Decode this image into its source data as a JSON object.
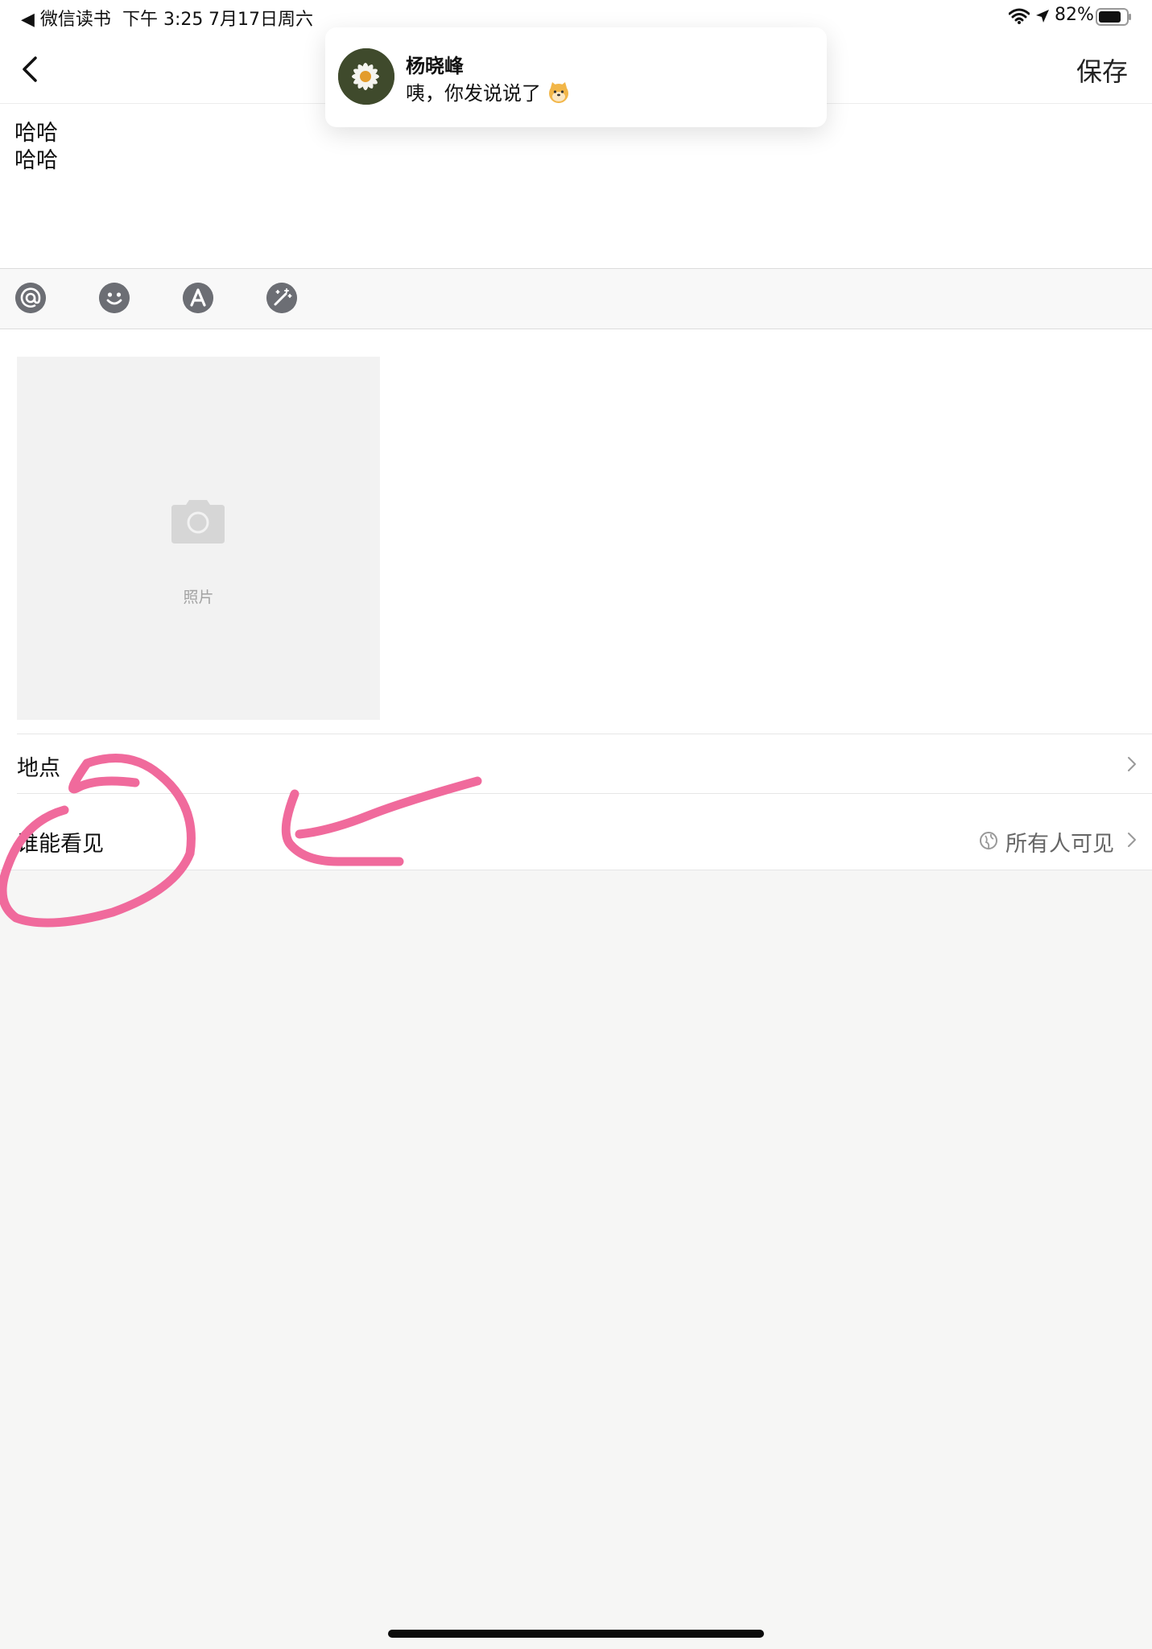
{
  "status_bar": {
    "back_app": "◀ 微信读书",
    "time": "下午 3:25",
    "date": "7月17日周六",
    "battery": "82%"
  },
  "header": {
    "save_label": "保存"
  },
  "notification": {
    "sender": "杨晓峰",
    "message": "咦，你发说说了",
    "avatar_icon": "daisy-photo"
  },
  "editor": {
    "lines": [
      "哈哈",
      "哈哈"
    ]
  },
  "toolbar": {
    "icons": [
      "at-icon",
      "emoji-icon",
      "font-icon",
      "magic-wand-icon"
    ]
  },
  "photo": {
    "label": "照片"
  },
  "location": {
    "label": "地点"
  },
  "visibility": {
    "label": "谁能看见",
    "value": "所有人可见"
  },
  "colors": {
    "annotation": "#f06a9c",
    "toolbar_icon": "#6c6e74",
    "page_bg": "#f6f6f5"
  }
}
